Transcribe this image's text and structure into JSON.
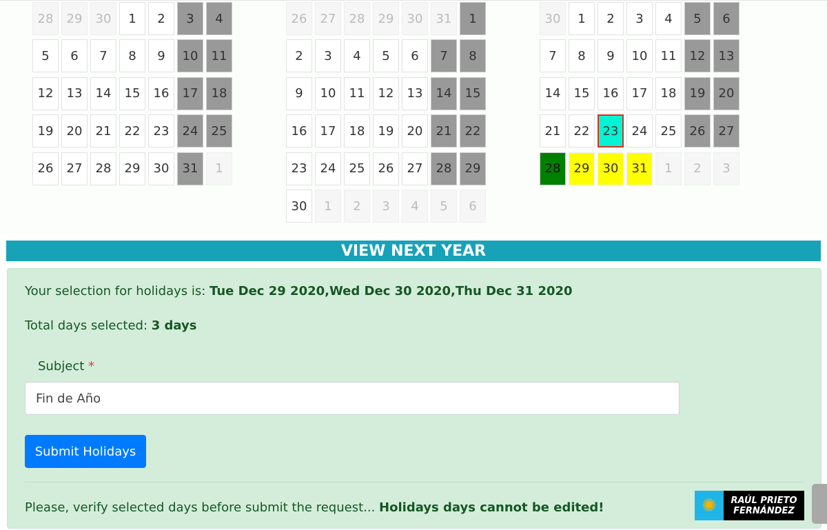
{
  "calendar": {
    "months": [
      {
        "weeks": [
          [
            [
              28,
              "o"
            ],
            [
              29,
              "o"
            ],
            [
              30,
              "o"
            ],
            [
              1,
              "n"
            ],
            [
              2,
              "n"
            ],
            [
              3,
              "w"
            ],
            [
              4,
              "w"
            ]
          ],
          [
            [
              5,
              "n"
            ],
            [
              6,
              "n"
            ],
            [
              7,
              "n"
            ],
            [
              8,
              "n"
            ],
            [
              9,
              "n"
            ],
            [
              10,
              "w"
            ],
            [
              11,
              "w"
            ]
          ],
          [
            [
              12,
              "n"
            ],
            [
              13,
              "n"
            ],
            [
              14,
              "n"
            ],
            [
              15,
              "n"
            ],
            [
              16,
              "n"
            ],
            [
              17,
              "w"
            ],
            [
              18,
              "w"
            ]
          ],
          [
            [
              19,
              "n"
            ],
            [
              20,
              "n"
            ],
            [
              21,
              "n"
            ],
            [
              22,
              "n"
            ],
            [
              23,
              "n"
            ],
            [
              24,
              "w"
            ],
            [
              25,
              "w"
            ]
          ],
          [
            [
              26,
              "n"
            ],
            [
              27,
              "n"
            ],
            [
              28,
              "n"
            ],
            [
              29,
              "n"
            ],
            [
              30,
              "n"
            ],
            [
              31,
              "w"
            ],
            [
              1,
              "o"
            ]
          ]
        ]
      },
      {
        "weeks": [
          [
            [
              26,
              "o"
            ],
            [
              27,
              "o"
            ],
            [
              28,
              "o"
            ],
            [
              29,
              "o"
            ],
            [
              30,
              "o"
            ],
            [
              31,
              "o"
            ],
            [
              1,
              "w"
            ]
          ],
          [
            [
              2,
              "n"
            ],
            [
              3,
              "n"
            ],
            [
              4,
              "n"
            ],
            [
              5,
              "n"
            ],
            [
              6,
              "n"
            ],
            [
              7,
              "w"
            ],
            [
              8,
              "w"
            ]
          ],
          [
            [
              9,
              "n"
            ],
            [
              10,
              "n"
            ],
            [
              11,
              "n"
            ],
            [
              12,
              "n"
            ],
            [
              13,
              "n"
            ],
            [
              14,
              "w"
            ],
            [
              15,
              "w"
            ]
          ],
          [
            [
              16,
              "n"
            ],
            [
              17,
              "n"
            ],
            [
              18,
              "n"
            ],
            [
              19,
              "n"
            ],
            [
              20,
              "n"
            ],
            [
              21,
              "w"
            ],
            [
              22,
              "w"
            ]
          ],
          [
            [
              23,
              "n"
            ],
            [
              24,
              "n"
            ],
            [
              25,
              "n"
            ],
            [
              26,
              "n"
            ],
            [
              27,
              "n"
            ],
            [
              28,
              "w"
            ],
            [
              29,
              "w"
            ]
          ],
          [
            [
              30,
              "n"
            ],
            [
              1,
              "o"
            ],
            [
              2,
              "o"
            ],
            [
              3,
              "o"
            ],
            [
              4,
              "o"
            ],
            [
              5,
              "o"
            ],
            [
              6,
              "o"
            ]
          ]
        ]
      },
      {
        "weeks": [
          [
            [
              30,
              "o"
            ],
            [
              1,
              "n"
            ],
            [
              2,
              "n"
            ],
            [
              3,
              "n"
            ],
            [
              4,
              "n"
            ],
            [
              5,
              "w"
            ],
            [
              6,
              "w"
            ]
          ],
          [
            [
              7,
              "n"
            ],
            [
              8,
              "n"
            ],
            [
              9,
              "n"
            ],
            [
              10,
              "n"
            ],
            [
              11,
              "n"
            ],
            [
              12,
              "w"
            ],
            [
              13,
              "w"
            ]
          ],
          [
            [
              14,
              "n"
            ],
            [
              15,
              "n"
            ],
            [
              16,
              "n"
            ],
            [
              17,
              "n"
            ],
            [
              18,
              "n"
            ],
            [
              19,
              "w"
            ],
            [
              20,
              "w"
            ]
          ],
          [
            [
              21,
              "n"
            ],
            [
              22,
              "n"
            ],
            [
              23,
              "t"
            ],
            [
              24,
              "n"
            ],
            [
              25,
              "n"
            ],
            [
              26,
              "w"
            ],
            [
              27,
              "w"
            ]
          ],
          [
            [
              28,
              "h"
            ],
            [
              29,
              "s"
            ],
            [
              30,
              "s"
            ],
            [
              31,
              "s"
            ],
            [
              1,
              "o"
            ],
            [
              2,
              "o"
            ],
            [
              3,
              "o"
            ]
          ]
        ]
      }
    ],
    "colors": {
      "weekend": "#999999",
      "today": "#00f5d4",
      "today_border": "#d9301e",
      "holiday": "#008000",
      "selected": "#ffff00"
    }
  },
  "banner": "VIEW NEXT YEAR",
  "summary": {
    "selection_label": "Your selection for holidays is: ",
    "selection_value": "Tue Dec 29 2020,Wed Dec 30 2020,Thu Dec 31 2020",
    "total_label": "Total days selected: ",
    "total_value": "3 days"
  },
  "form": {
    "subject_label": "Subject",
    "required_mark": "*",
    "subject_value": "Fin de Año",
    "submit_label": "Submit Holidays"
  },
  "footer": {
    "note": "Please, verify selected days before submit the request... ",
    "warning": "Holidays days cannot be edited!"
  },
  "logo": {
    "line1": "RAÚL PRIETO",
    "line2": "FERNÁNDEZ",
    "icon": "brain-circuit-icon"
  }
}
